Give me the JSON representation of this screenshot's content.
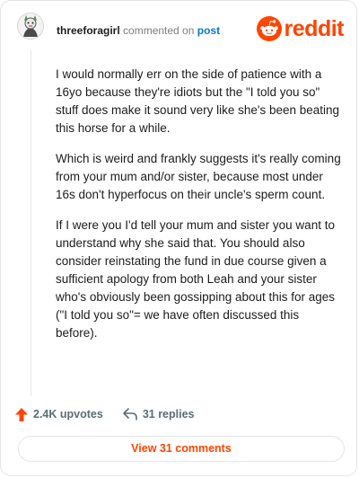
{
  "comment": {
    "username": "threeforagirl",
    "action_text": "commented on",
    "target_text": "post",
    "paragraphs": [
      "I would normally err on the side of patience with a 16yo because they're idiots but the \"I told you so\" stuff does make it sound very like she's been beating this horse for a while.",
      "Which is weird and frankly suggests it's really coming from your mum and/or sister, because most under 16s don't hyperfocus on their uncle's sperm count.",
      "If I were you I'd tell your mum and sister you want to understand why she said that. You should also consider reinstating the fund in due course given a sufficient apology from both Leah and your sister who's obviously been gossipping about this for ages (\"I told you so\"= we have often discussed this before)."
    ]
  },
  "brand": {
    "name": "reddit",
    "color": "#ff4500"
  },
  "actions": {
    "upvotes": "2.4K upvotes",
    "replies": "31 replies",
    "upvote_icon": "upvote-arrow-icon",
    "reply_icon": "reply-arrow-icon"
  },
  "footer": {
    "view_comments": "View 31 comments"
  },
  "colors": {
    "accent": "#ff4500",
    "link": "#0079d3",
    "muted": "#576f76"
  }
}
